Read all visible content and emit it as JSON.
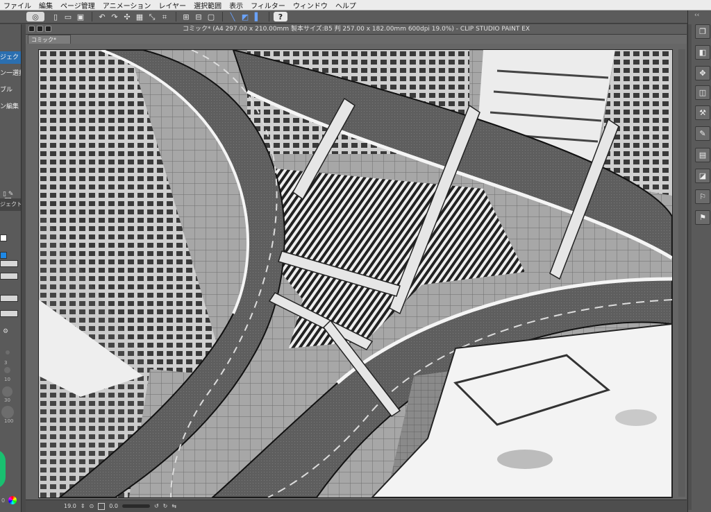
{
  "menubar": {
    "items": [
      "ファイル",
      "編集",
      "ページ管理",
      "アニメーション",
      "レイヤー",
      "選択範囲",
      "表示",
      "フィルター",
      "ウィンドウ",
      "ヘルプ"
    ]
  },
  "toolbar": {
    "icons": [
      "clip-studio-logo-icon",
      "new-file-icon",
      "open-file-icon",
      "save-icon",
      "undo-icon",
      "redo-icon",
      "transform-icon",
      "crop-icon",
      "select-icon",
      "fill-icon",
      "snap-ruler-icon",
      "snap-special-ruler-icon",
      "snap-grid-icon",
      "help-icon"
    ]
  },
  "left_panel": {
    "items": [
      {
        "label": "ジェクト",
        "selected": true
      },
      {
        "label": "ン一選択",
        "selected": false
      },
      {
        "label": "ブル",
        "selected": false
      },
      {
        "label": "ン編集",
        "selected": false
      },
      {
        "label": "ジェクト]",
        "selected": false
      }
    ],
    "brush_sizes": [
      "3",
      "10",
      "30",
      "100"
    ],
    "bottom_label": "0"
  },
  "document": {
    "title": "コミック* (A4 297.00 x 210.00mm 製本サイズ:B5 判 257.00 x 182.00mm 600dpi 19.0%)  - CLIP STUDIO PAINT EX",
    "tab_label": "コミック*",
    "zoom": "19.0",
    "rotation": "0.0"
  },
  "colors": {
    "selected": "#2b6fb0",
    "panel": "#5a5a5a",
    "accent_green": "#19c070"
  },
  "right_panel": {
    "icons": [
      "layer-icon",
      "layer-property-icon",
      "navigator-icon",
      "material-icon",
      "tool-property-icon",
      "sub-tool-icon",
      "history-icon",
      "auto-action-icon",
      "item-bank-icon",
      "page-icon"
    ]
  }
}
